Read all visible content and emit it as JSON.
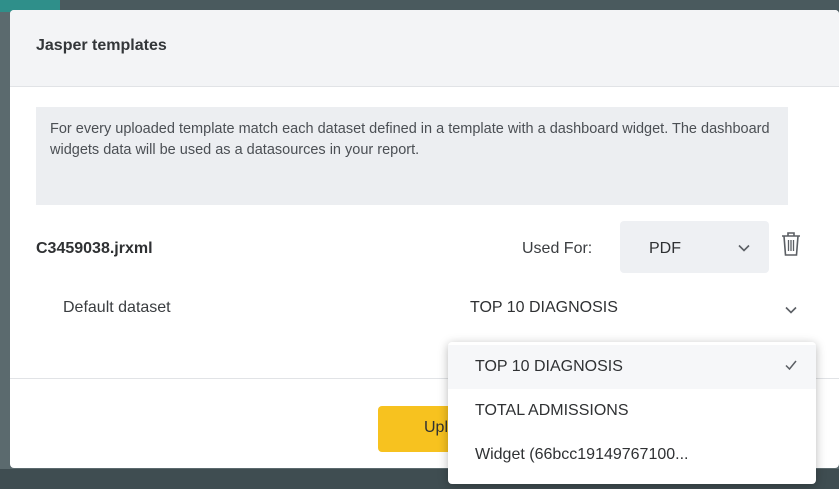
{
  "modal": {
    "title": "Jasper templates",
    "info_text": "For every uploaded template match each dataset defined in a template with a dashboard widget. The dashboard widgets data will be used as a datasources in your report."
  },
  "template": {
    "file_name": "C3459038.jrxml",
    "used_for_label": "Used For:",
    "used_for_value": "PDF",
    "dataset_label": "Default dataset",
    "dataset_value": "TOP 10 DIAGNOSIS"
  },
  "dropdown": {
    "options": [
      {
        "label": "TOP 10 DIAGNOSIS",
        "selected": true
      },
      {
        "label": "TOTAL ADMISSIONS",
        "selected": false
      },
      {
        "label": "Widget (66bcc19149767100...",
        "selected": false
      }
    ]
  },
  "footer": {
    "upload_label": "Upload"
  },
  "icons": {
    "trash": "trash-icon",
    "chevron": "chevron-down-icon",
    "check": "check-icon"
  },
  "colors": {
    "primary_button": "#f7c21f",
    "header_bg": "#f3f4f6",
    "info_bg": "#eceef1"
  }
}
